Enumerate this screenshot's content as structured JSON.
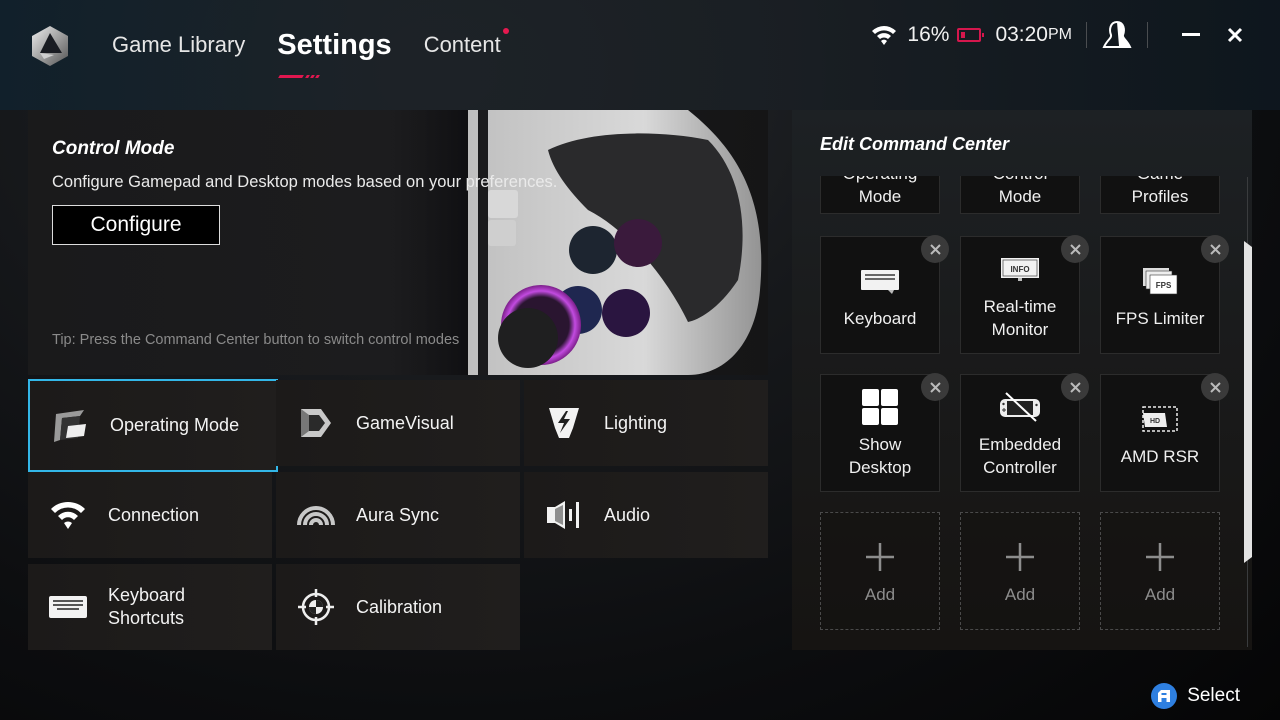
{
  "header": {
    "nav": [
      {
        "label": "Game Library",
        "active": false
      },
      {
        "label": "Settings",
        "active": true
      },
      {
        "label": "Content",
        "active": false,
        "notification": true
      }
    ],
    "status": {
      "wifi_icon": "wifi-icon",
      "battery_percent": "16%",
      "battery_icon": "battery-low-icon",
      "time": "03:20",
      "ampm": "PM",
      "account_icon": "user-icon"
    },
    "window_controls": {
      "minimize": "minimize-icon",
      "close": "close-icon"
    }
  },
  "control_mode": {
    "title": "Control Mode",
    "description": "Configure Gamepad and Desktop modes based on your preferences.",
    "configure_label": "Configure",
    "tip": "Tip: Press the Command Center button to switch control modes"
  },
  "settings_tiles": [
    {
      "label": "Operating Mode",
      "icon": "operating-mode-icon",
      "selected": true
    },
    {
      "label": "GameVisual",
      "icon": "gamevisual-icon"
    },
    {
      "label": "Lighting",
      "icon": "lighting-icon"
    },
    {
      "label": "Connection",
      "icon": "wifi-icon"
    },
    {
      "label": "Aura Sync",
      "icon": "aura-sync-icon"
    },
    {
      "label": "Audio",
      "icon": "speaker-icon"
    },
    {
      "label": "Keyboard\nShortcuts",
      "icon": "keyboard-icon"
    },
    {
      "label": "Calibration",
      "icon": "crosshair-icon"
    }
  ],
  "command_center": {
    "title": "Edit Command Center",
    "tiles": [
      {
        "label": "Operating\nMode",
        "removable": false
      },
      {
        "label": "Control\nMode",
        "removable": false
      },
      {
        "label": "Game\nProfiles",
        "removable": false
      },
      {
        "label": "Keyboard",
        "icon": "keyboard-icon",
        "removable": true
      },
      {
        "label": "Real-time\nMonitor",
        "icon": "info-monitor-icon",
        "icon_text": "INFO",
        "removable": true
      },
      {
        "label": "FPS Limiter",
        "icon": "fps-icon",
        "icon_text": "FPS",
        "removable": true
      },
      {
        "label": "Show\nDesktop",
        "icon": "windows-icon",
        "removable": true
      },
      {
        "label": "Embedded\nController",
        "icon": "controller-disabled-icon",
        "removable": true
      },
      {
        "label": "AMD RSR",
        "icon": "hd-upscale-icon",
        "icon_text": "HD",
        "removable": true
      },
      {
        "label": "Add",
        "icon": "plus-icon",
        "add": true
      },
      {
        "label": "Add",
        "icon": "plus-icon",
        "add": true
      },
      {
        "label": "Add",
        "icon": "plus-icon",
        "add": true
      }
    ]
  },
  "footer": {
    "button_glyph": "A",
    "select_label": "Select"
  }
}
